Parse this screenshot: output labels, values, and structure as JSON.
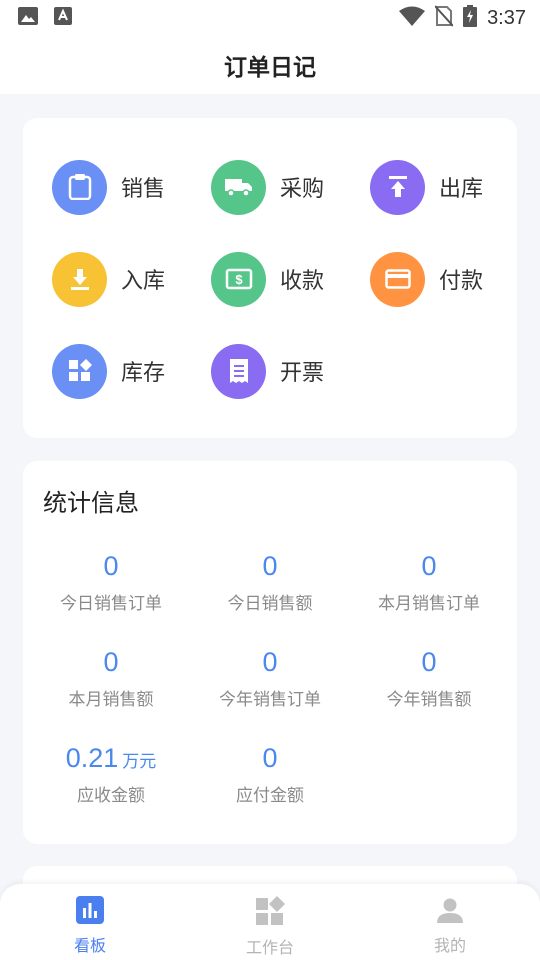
{
  "status_bar": {
    "time": "3:37"
  },
  "app_bar": {
    "title": "订单日记"
  },
  "actions": [
    {
      "label": "销售",
      "icon": "clipboard-icon",
      "color": "#6a8ff5"
    },
    {
      "label": "采购",
      "icon": "truck-icon",
      "color": "#55c58a"
    },
    {
      "label": "出库",
      "icon": "upload-icon",
      "color": "#8a6cf2"
    },
    {
      "label": "入库",
      "icon": "download-icon",
      "color": "#f7c234"
    },
    {
      "label": "收款",
      "icon": "cash-icon",
      "color": "#55c58a"
    },
    {
      "label": "付款",
      "icon": "card-icon",
      "color": "#ff9342"
    },
    {
      "label": "库存",
      "icon": "grid-icon",
      "color": "#6a8ff5"
    },
    {
      "label": "开票",
      "icon": "receipt-icon",
      "color": "#8a6cf2"
    }
  ],
  "stats": {
    "title": "统计信息",
    "items": [
      {
        "value": "0",
        "caption": "今日销售订单"
      },
      {
        "value": "0",
        "caption": "今日销售额"
      },
      {
        "value": "0",
        "caption": "本月销售订单"
      },
      {
        "value": "0",
        "caption": "本月销售额"
      },
      {
        "value": "0",
        "caption": "今年销售订单"
      },
      {
        "value": "0",
        "caption": "今年销售额"
      },
      {
        "value": "0.21",
        "unit": "万元",
        "caption": "应收金额"
      },
      {
        "value": "0",
        "caption": "应付金额"
      }
    ]
  },
  "tabs": [
    {
      "label": "看板",
      "icon": "bar-chart-icon",
      "active": true
    },
    {
      "label": "工作台",
      "icon": "widgets-icon",
      "active": false
    },
    {
      "label": "我的",
      "icon": "person-icon",
      "active": false
    }
  ],
  "colors": {
    "accent": "#4a88f0",
    "tab_active": "#4a7ff0",
    "tab_inactive": "#b4b4b4"
  }
}
